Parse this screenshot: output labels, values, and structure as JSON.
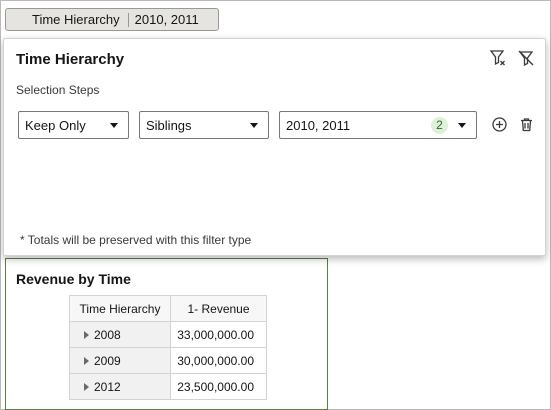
{
  "filter_chip": {
    "label": "Time Hierarchy",
    "value": "2010, 2011"
  },
  "popup": {
    "title": "Time Hierarchy",
    "steps_label": "Selection Steps",
    "step": {
      "action": "Keep Only",
      "relation": "Siblings",
      "members": "2010, 2011",
      "member_count": "2"
    },
    "note": "* Totals will be preserved with this filter type",
    "icons": [
      "clear-filter-icon",
      "filter-off-icon",
      "add-step-icon",
      "delete-step-icon"
    ]
  },
  "report": {
    "title": "Revenue by Time",
    "columns": [
      "Time Hierarchy",
      "1- Revenue"
    ],
    "rows": [
      {
        "member": "2008",
        "value": "33,000,000.00"
      },
      {
        "member": "2009",
        "value": "30,000,000.00"
      },
      {
        "member": "2012",
        "value": "23,500,000.00"
      }
    ]
  },
  "colors": {
    "report_border": "#5b7d46",
    "badge_bg": "#dff0d8",
    "badge_text": "#2f6b2c"
  }
}
